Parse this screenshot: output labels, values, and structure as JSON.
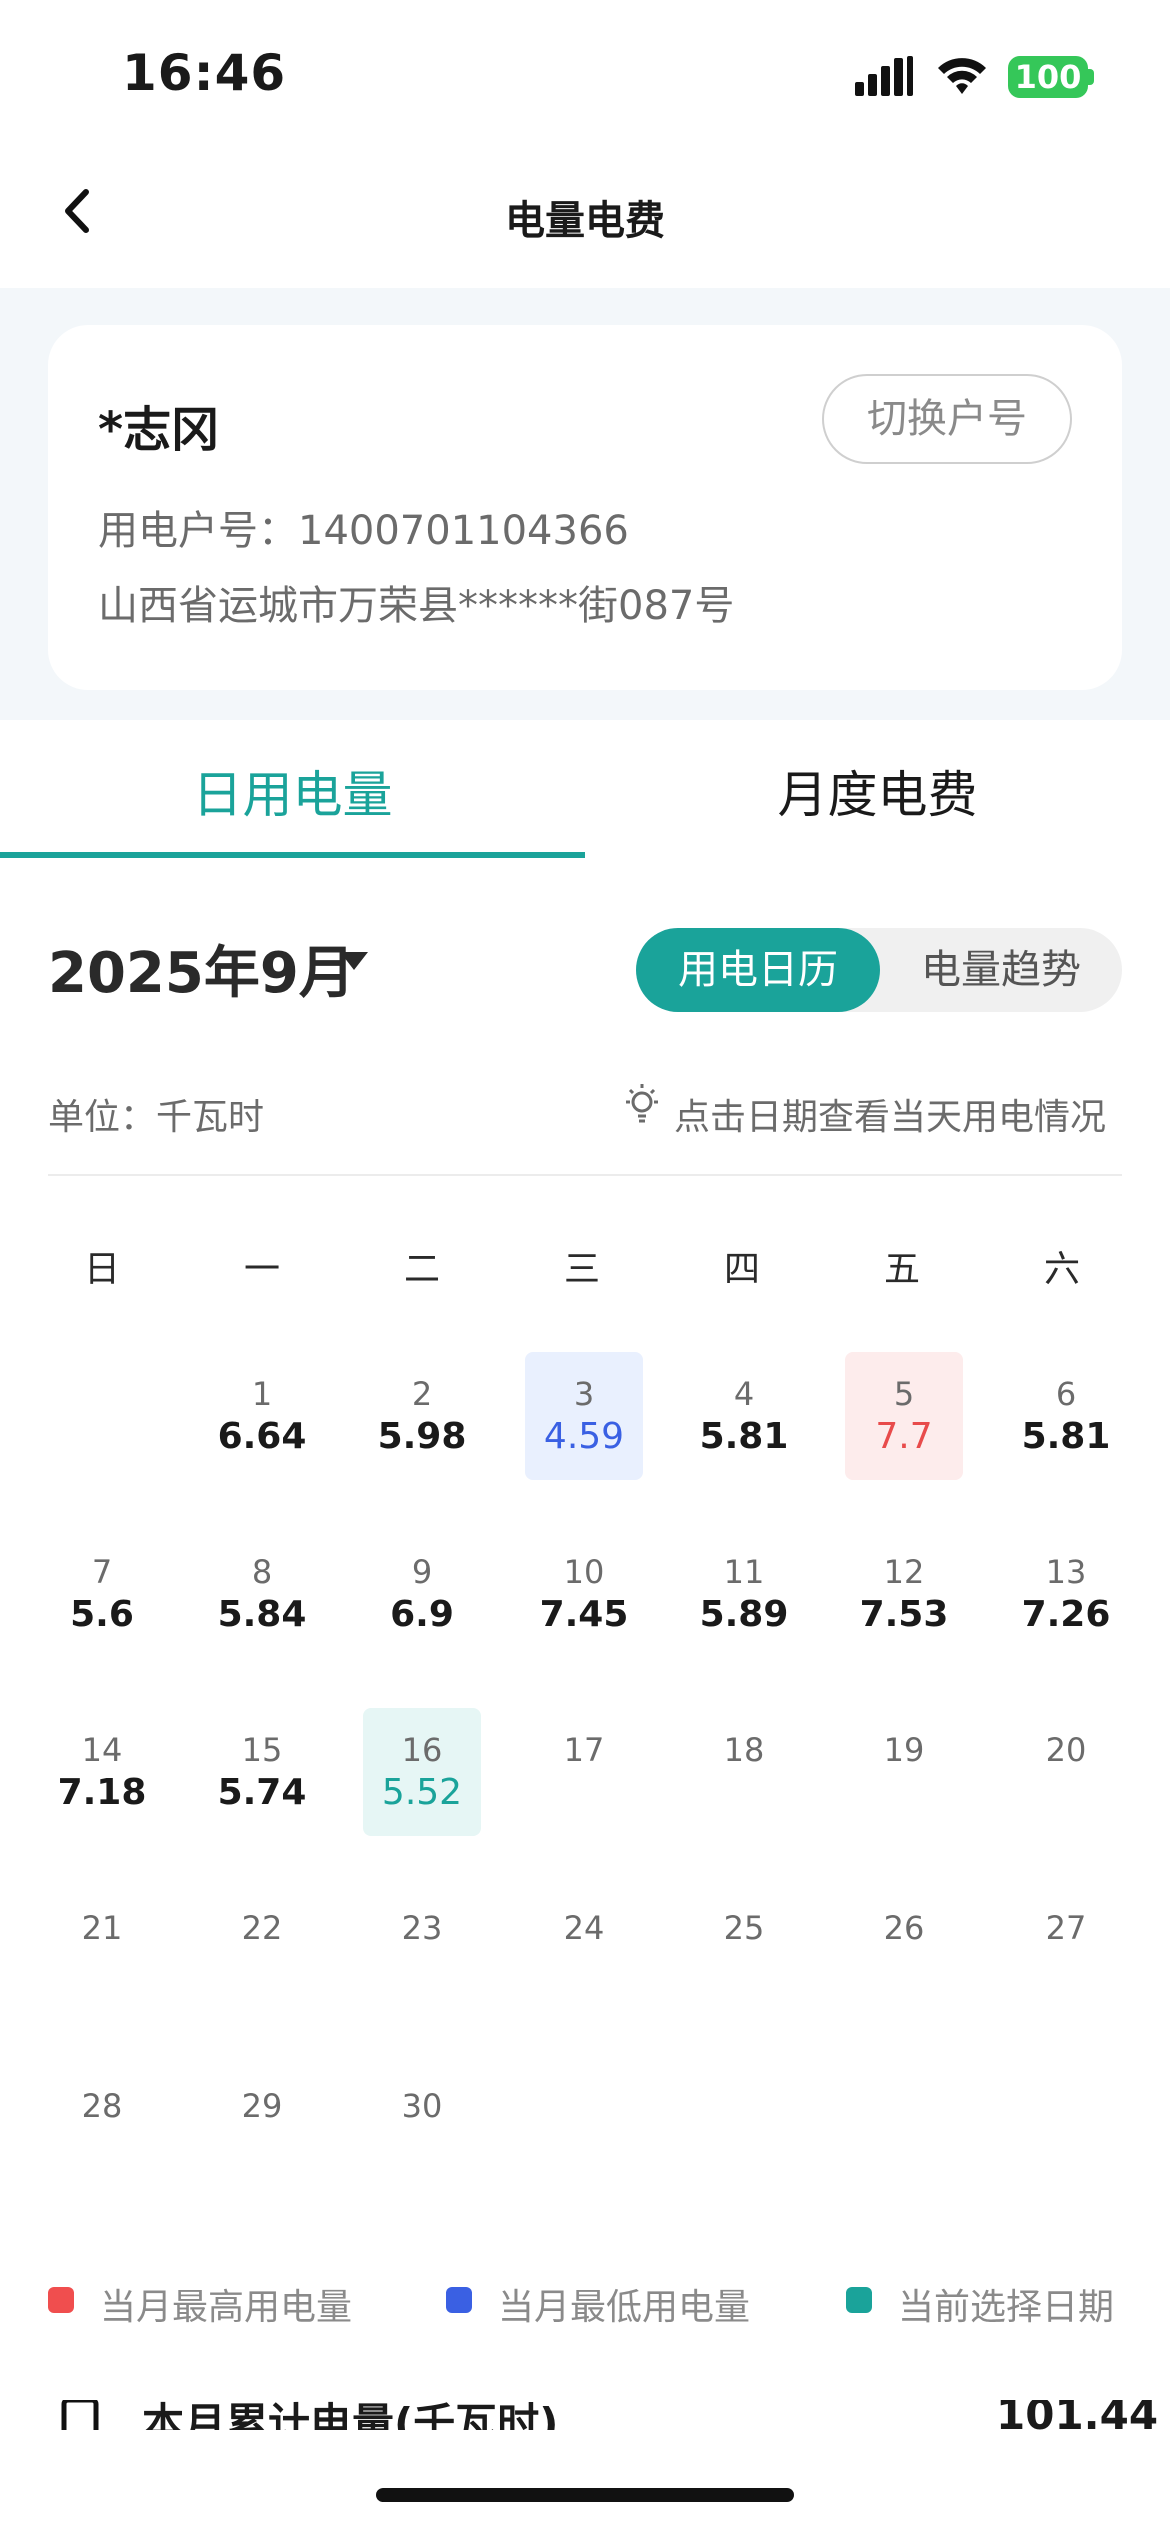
{
  "status_bar": {
    "time": "16:46",
    "battery": "100"
  },
  "nav": {
    "title": "电量电费"
  },
  "account": {
    "name": "*志冈",
    "switch_label": "切换户号",
    "number": "用电户号：1400701104366",
    "address": "山西省运城市万荣县******街087号"
  },
  "tabs": {
    "daily": "日用电量",
    "monthly": "月度电费"
  },
  "month_selector": {
    "label": "2025年9月"
  },
  "view_toggle": {
    "calendar": "用电日历",
    "trend": "电量趋势"
  },
  "unit": "单位：千瓦时",
  "hint": "点击日期查看当天用电情况",
  "weekdays": [
    "日",
    "一",
    "二",
    "三",
    "四",
    "五",
    "六"
  ],
  "calendar": {
    "days": [
      {
        "d": "1",
        "v": "6.64"
      },
      {
        "d": "2",
        "v": "5.98"
      },
      {
        "d": "3",
        "v": "4.59"
      },
      {
        "d": "4",
        "v": "5.81"
      },
      {
        "d": "5",
        "v": "7.7"
      },
      {
        "d": "6",
        "v": "5.81"
      },
      {
        "d": "7",
        "v": "5.6"
      },
      {
        "d": "8",
        "v": "5.84"
      },
      {
        "d": "9",
        "v": "6.9"
      },
      {
        "d": "10",
        "v": "7.45"
      },
      {
        "d": "11",
        "v": "5.89"
      },
      {
        "d": "12",
        "v": "7.53"
      },
      {
        "d": "13",
        "v": "7.26"
      },
      {
        "d": "14",
        "v": "7.18"
      },
      {
        "d": "15",
        "v": "5.74"
      },
      {
        "d": "16",
        "v": "5.52"
      },
      {
        "d": "17",
        "v": ""
      },
      {
        "d": "18",
        "v": ""
      },
      {
        "d": "19",
        "v": ""
      },
      {
        "d": "20",
        "v": ""
      },
      {
        "d": "21",
        "v": ""
      },
      {
        "d": "22",
        "v": ""
      },
      {
        "d": "23",
        "v": ""
      },
      {
        "d": "24",
        "v": ""
      },
      {
        "d": "25",
        "v": ""
      },
      {
        "d": "26",
        "v": ""
      },
      {
        "d": "27",
        "v": ""
      },
      {
        "d": "28",
        "v": ""
      },
      {
        "d": "29",
        "v": ""
      },
      {
        "d": "30",
        "v": ""
      }
    ],
    "highest_day": "5",
    "lowest_day": "3",
    "selected_day": "16"
  },
  "legend": {
    "highest": "当月最高用电量",
    "lowest": "当月最低用电量",
    "selected": "当前选择日期"
  },
  "colors": {
    "accent": "#1aa39a",
    "highest": "#e84b4b",
    "lowest": "#3a60e3"
  },
  "summary": {
    "label": "本月累计电量(千瓦时)",
    "value": "101.44"
  }
}
